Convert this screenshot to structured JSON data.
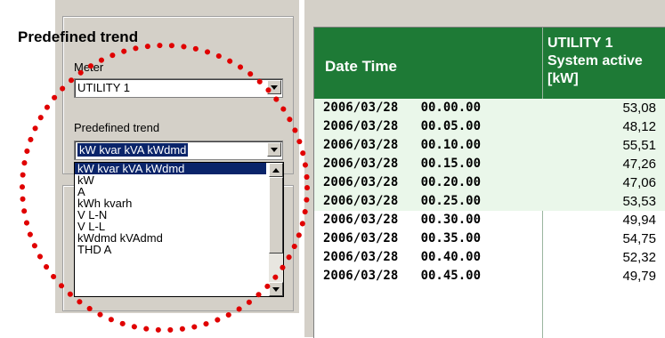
{
  "left_panel": {
    "title": "Predefined trend",
    "meter_label": "Meter",
    "meter_value": "UTILITY 1",
    "predefined_label": "Predefined trend",
    "predefined_value": "kW kvar kVA kWdmd",
    "dropdown_items": [
      "kW kvar kVA kWdmd",
      "kW",
      "A",
      "kWh kvarh",
      "V L-N",
      "V L-L",
      "kWdmd kVAdmd",
      "THD A"
    ]
  },
  "grid": {
    "col_datetime": "Date Time",
    "col_value_line1": "UTILITY 1",
    "col_value_line2": "System active",
    "col_value_line3": "[kW]",
    "rows": [
      {
        "datetime": "2006/03/28   00.00.00",
        "value": "53,08"
      },
      {
        "datetime": "2006/03/28   00.05.00",
        "value": "48,12"
      },
      {
        "datetime": "2006/03/28   00.10.00",
        "value": "55,51"
      },
      {
        "datetime": "2006/03/28   00.15.00",
        "value": "47,26"
      },
      {
        "datetime": "2006/03/28   00.20.00",
        "value": "47,06"
      },
      {
        "datetime": "2006/03/28   00.25.00",
        "value": "53,53"
      },
      {
        "datetime": "2006/03/28   00.30.00",
        "value": "49,94"
      },
      {
        "datetime": "2006/03/28   00.35.00",
        "value": "54,75"
      },
      {
        "datetime": "2006/03/28   00.40.00",
        "value": "52,32"
      },
      {
        "datetime": "2006/03/28   00.45.00",
        "value": "49,79"
      }
    ]
  },
  "colors": {
    "header_green": "#1e7a36",
    "highlight_row": "#eaf7ea",
    "annotation_red": "#e00000",
    "selection_blue": "#0a246a"
  }
}
